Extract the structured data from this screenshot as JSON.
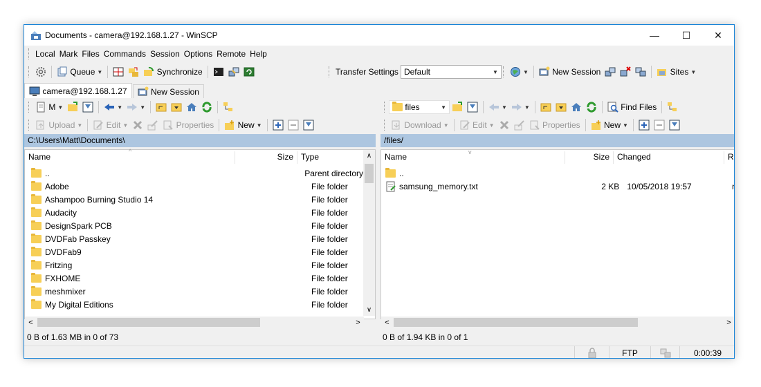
{
  "window": {
    "title": "Documents - camera@192.168.1.27 - WinSCP",
    "min": "—",
    "max": "☐",
    "close": "✕"
  },
  "menu": [
    "Local",
    "Mark",
    "Files",
    "Commands",
    "Session",
    "Options",
    "Remote",
    "Help"
  ],
  "toolbar": {
    "queue": "Queue",
    "synchronize": "Synchronize",
    "transfer_settings_label": "Transfer Settings",
    "transfer_settings_value": "Default",
    "new_session": "New Session",
    "sites": "Sites"
  },
  "tabs": {
    "session": "camera@192.168.1.27",
    "new_session": "New Session"
  },
  "left": {
    "drive": "M",
    "upload": "Upload",
    "edit": "Edit",
    "properties": "Properties",
    "new": "New",
    "path": "C:\\Users\\Matt\\Documents\\",
    "columns": {
      "name": "Name",
      "size": "Size",
      "type": "Type"
    },
    "rows": [
      {
        "name": "..",
        "type": "Parent directory"
      },
      {
        "name": "Adobe",
        "type": "File folder"
      },
      {
        "name": "Ashampoo Burning Studio 14",
        "type": "File folder"
      },
      {
        "name": "Audacity",
        "type": "File folder"
      },
      {
        "name": "DesignSpark PCB",
        "type": "File folder"
      },
      {
        "name": "DVDFab Passkey",
        "type": "File folder"
      },
      {
        "name": "DVDFab9",
        "type": "File folder"
      },
      {
        "name": "Fritzing",
        "type": "File folder"
      },
      {
        "name": "FXHOME",
        "type": "File folder"
      },
      {
        "name": "meshmixer",
        "type": "File folder"
      },
      {
        "name": "My Digital Editions",
        "type": "File folder"
      }
    ],
    "status": "0 B of 1.63 MB in 0 of 73"
  },
  "right": {
    "dir": "files",
    "find_files": "Find Files",
    "download": "Download",
    "edit": "Edit",
    "properties": "Properties",
    "new": "New",
    "path": "/files/",
    "columns": {
      "name": "Name",
      "size": "Size",
      "changed": "Changed",
      "rights": "R"
    },
    "rows": [
      {
        "name": "..",
        "size": "",
        "changed": "",
        "rights": ""
      },
      {
        "name": "samsung_memory.txt",
        "size": "2 KB",
        "changed": "10/05/2018 19:57",
        "rights": "r"
      }
    ],
    "status": "0 B of 1.94 KB in 0 of 1"
  },
  "statusbar": {
    "protocol": "FTP",
    "time": "0:00:39"
  },
  "colors": {
    "accent": "#1883d7",
    "pathbar": "#adc6e0",
    "folder": "#f7cf57"
  }
}
